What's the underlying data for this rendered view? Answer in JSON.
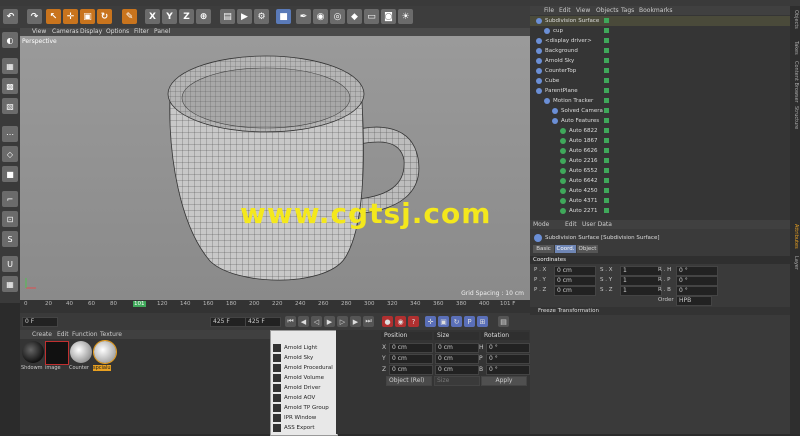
{
  "viewport_menu": [
    "View",
    "Cameras",
    "Display",
    "Options",
    "Filter",
    "Panel"
  ],
  "viewport": {
    "label": "Perspective",
    "grid_spacing": "Grid Spacing : 10 cm"
  },
  "watermark": "www.cgtsj.com",
  "timeline": {
    "ticks": [
      "0",
      "20",
      "40",
      "60",
      "80",
      "101",
      "120",
      "140",
      "160",
      "180",
      "200",
      "220",
      "240",
      "260",
      "280",
      "300",
      "320",
      "340",
      "360",
      "380",
      "400",
      "420"
    ],
    "current_frame": "101 F"
  },
  "playbar": {
    "start": "0 F",
    "end_a": "425 F",
    "end_b": "425 F"
  },
  "material_panel": {
    "menu": [
      "Create",
      "Edit",
      "Function",
      "Texture"
    ],
    "materials": [
      "Shdowm",
      "image",
      "Counter",
      "spcialu"
    ]
  },
  "arnold_menu": [
    "Arnold Light",
    "Arnold Sky",
    "Arnold Procedural",
    "Arnold Volume",
    "Arnold Driver",
    "Arnold AOV",
    "Arnold TP Group",
    "IPR Window",
    "ASS Export"
  ],
  "coordinates_panel": {
    "headers": [
      "Position",
      "Size",
      "Rotation"
    ],
    "rows": [
      {
        "axis": "X",
        "pos": "0 cm",
        "size": "0 cm",
        "rot_axis": "H",
        "rot": "0 °"
      },
      {
        "axis": "Y",
        "pos": "0 cm",
        "size": "0 cm",
        "rot_axis": "P",
        "rot": "0 °"
      },
      {
        "axis": "Z",
        "pos": "0 cm",
        "size": "0 cm",
        "rot_axis": "B",
        "rot": "0 °"
      }
    ],
    "mode": "Object (Rel)",
    "size_mode": "Size",
    "apply": "Apply"
  },
  "object_manager": {
    "menu": [
      "File",
      "Edit",
      "View",
      "Objects",
      "Tags",
      "Bookmarks"
    ],
    "items": [
      {
        "name": "Subdivision Surface",
        "indent": 0
      },
      {
        "name": "cup",
        "indent": 1
      },
      {
        "name": "<display driver>",
        "indent": 0
      },
      {
        "name": "Background",
        "indent": 0
      },
      {
        "name": "Arnold Sky",
        "indent": 0
      },
      {
        "name": "CounterTop",
        "indent": 0
      },
      {
        "name": "Cube",
        "indent": 0
      },
      {
        "name": "ParentPlane",
        "indent": 0
      },
      {
        "name": "Motion Tracker",
        "indent": 1
      },
      {
        "name": "Solved Camera",
        "indent": 2
      },
      {
        "name": "Auto Features",
        "indent": 2
      },
      {
        "name": "Auto 6822",
        "indent": 3
      },
      {
        "name": "Auto 1867",
        "indent": 3
      },
      {
        "name": "Auto 6626",
        "indent": 3
      },
      {
        "name": "Auto 2216",
        "indent": 3
      },
      {
        "name": "Auto 6552",
        "indent": 3
      },
      {
        "name": "Auto 6642",
        "indent": 3
      },
      {
        "name": "Auto 4250",
        "indent": 3
      },
      {
        "name": "Auto 4371",
        "indent": 3
      },
      {
        "name": "Auto 2271",
        "indent": 3
      }
    ]
  },
  "attribute_manager": {
    "menu": [
      "Mode",
      "Edit",
      "User Data"
    ],
    "title": "Subdivision Surface [Subdivision Surface]",
    "tabs": [
      "Basic",
      "Coord.",
      "Object"
    ],
    "section": "Coordinates",
    "rows": [
      {
        "p": "P . X",
        "pv": "0 cm",
        "s": "S . X",
        "sv": "1",
        "r": "R . H",
        "rv": "0 °"
      },
      {
        "p": "P . Y",
        "pv": "0 cm",
        "s": "S . Y",
        "sv": "1",
        "r": "R . P",
        "rv": "0 °"
      },
      {
        "p": "P . Z",
        "pv": "0 cm",
        "s": "S . Z",
        "sv": "1",
        "r": "R . B",
        "rv": "0 °"
      }
    ],
    "order_label": "Order",
    "order_value": "HPB",
    "freeze": "Freeze Transformation"
  },
  "side_tabs": [
    "Objects",
    "Takes",
    "Content Browser",
    "Structure",
    "Attributes",
    "Layer"
  ]
}
